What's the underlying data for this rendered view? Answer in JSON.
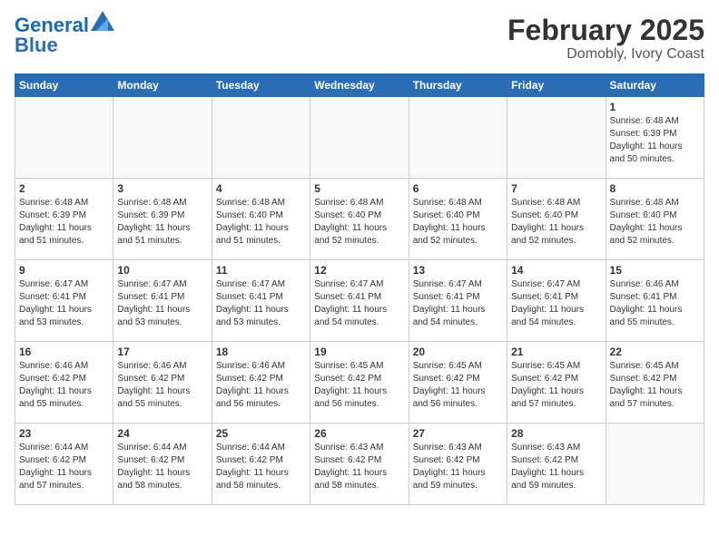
{
  "header": {
    "logo_line1": "General",
    "logo_line2": "Blue",
    "title": "February 2025",
    "subtitle": "Domobly, Ivory Coast"
  },
  "days_of_week": [
    "Sunday",
    "Monday",
    "Tuesday",
    "Wednesday",
    "Thursday",
    "Friday",
    "Saturday"
  ],
  "weeks": [
    [
      {
        "day": "",
        "info": ""
      },
      {
        "day": "",
        "info": ""
      },
      {
        "day": "",
        "info": ""
      },
      {
        "day": "",
        "info": ""
      },
      {
        "day": "",
        "info": ""
      },
      {
        "day": "",
        "info": ""
      },
      {
        "day": "1",
        "info": "Sunrise: 6:48 AM\nSunset: 6:39 PM\nDaylight: 11 hours\nand 50 minutes."
      }
    ],
    [
      {
        "day": "2",
        "info": "Sunrise: 6:48 AM\nSunset: 6:39 PM\nDaylight: 11 hours\nand 51 minutes."
      },
      {
        "day": "3",
        "info": "Sunrise: 6:48 AM\nSunset: 6:39 PM\nDaylight: 11 hours\nand 51 minutes."
      },
      {
        "day": "4",
        "info": "Sunrise: 6:48 AM\nSunset: 6:40 PM\nDaylight: 11 hours\nand 51 minutes."
      },
      {
        "day": "5",
        "info": "Sunrise: 6:48 AM\nSunset: 6:40 PM\nDaylight: 11 hours\nand 52 minutes."
      },
      {
        "day": "6",
        "info": "Sunrise: 6:48 AM\nSunset: 6:40 PM\nDaylight: 11 hours\nand 52 minutes."
      },
      {
        "day": "7",
        "info": "Sunrise: 6:48 AM\nSunset: 6:40 PM\nDaylight: 11 hours\nand 52 minutes."
      },
      {
        "day": "8",
        "info": "Sunrise: 6:48 AM\nSunset: 6:40 PM\nDaylight: 11 hours\nand 52 minutes."
      }
    ],
    [
      {
        "day": "9",
        "info": "Sunrise: 6:47 AM\nSunset: 6:41 PM\nDaylight: 11 hours\nand 53 minutes."
      },
      {
        "day": "10",
        "info": "Sunrise: 6:47 AM\nSunset: 6:41 PM\nDaylight: 11 hours\nand 53 minutes."
      },
      {
        "day": "11",
        "info": "Sunrise: 6:47 AM\nSunset: 6:41 PM\nDaylight: 11 hours\nand 53 minutes."
      },
      {
        "day": "12",
        "info": "Sunrise: 6:47 AM\nSunset: 6:41 PM\nDaylight: 11 hours\nand 54 minutes."
      },
      {
        "day": "13",
        "info": "Sunrise: 6:47 AM\nSunset: 6:41 PM\nDaylight: 11 hours\nand 54 minutes."
      },
      {
        "day": "14",
        "info": "Sunrise: 6:47 AM\nSunset: 6:41 PM\nDaylight: 11 hours\nand 54 minutes."
      },
      {
        "day": "15",
        "info": "Sunrise: 6:46 AM\nSunset: 6:41 PM\nDaylight: 11 hours\nand 55 minutes."
      }
    ],
    [
      {
        "day": "16",
        "info": "Sunrise: 6:46 AM\nSunset: 6:42 PM\nDaylight: 11 hours\nand 55 minutes."
      },
      {
        "day": "17",
        "info": "Sunrise: 6:46 AM\nSunset: 6:42 PM\nDaylight: 11 hours\nand 55 minutes."
      },
      {
        "day": "18",
        "info": "Sunrise: 6:46 AM\nSunset: 6:42 PM\nDaylight: 11 hours\nand 56 minutes."
      },
      {
        "day": "19",
        "info": "Sunrise: 6:45 AM\nSunset: 6:42 PM\nDaylight: 11 hours\nand 56 minutes."
      },
      {
        "day": "20",
        "info": "Sunrise: 6:45 AM\nSunset: 6:42 PM\nDaylight: 11 hours\nand 56 minutes."
      },
      {
        "day": "21",
        "info": "Sunrise: 6:45 AM\nSunset: 6:42 PM\nDaylight: 11 hours\nand 57 minutes."
      },
      {
        "day": "22",
        "info": "Sunrise: 6:45 AM\nSunset: 6:42 PM\nDaylight: 11 hours\nand 57 minutes."
      }
    ],
    [
      {
        "day": "23",
        "info": "Sunrise: 6:44 AM\nSunset: 6:42 PM\nDaylight: 11 hours\nand 57 minutes."
      },
      {
        "day": "24",
        "info": "Sunrise: 6:44 AM\nSunset: 6:42 PM\nDaylight: 11 hours\nand 58 minutes."
      },
      {
        "day": "25",
        "info": "Sunrise: 6:44 AM\nSunset: 6:42 PM\nDaylight: 11 hours\nand 58 minutes."
      },
      {
        "day": "26",
        "info": "Sunrise: 6:43 AM\nSunset: 6:42 PM\nDaylight: 11 hours\nand 58 minutes."
      },
      {
        "day": "27",
        "info": "Sunrise: 6:43 AM\nSunset: 6:42 PM\nDaylight: 11 hours\nand 59 minutes."
      },
      {
        "day": "28",
        "info": "Sunrise: 6:43 AM\nSunset: 6:42 PM\nDaylight: 11 hours\nand 59 minutes."
      },
      {
        "day": "",
        "info": ""
      }
    ]
  ]
}
